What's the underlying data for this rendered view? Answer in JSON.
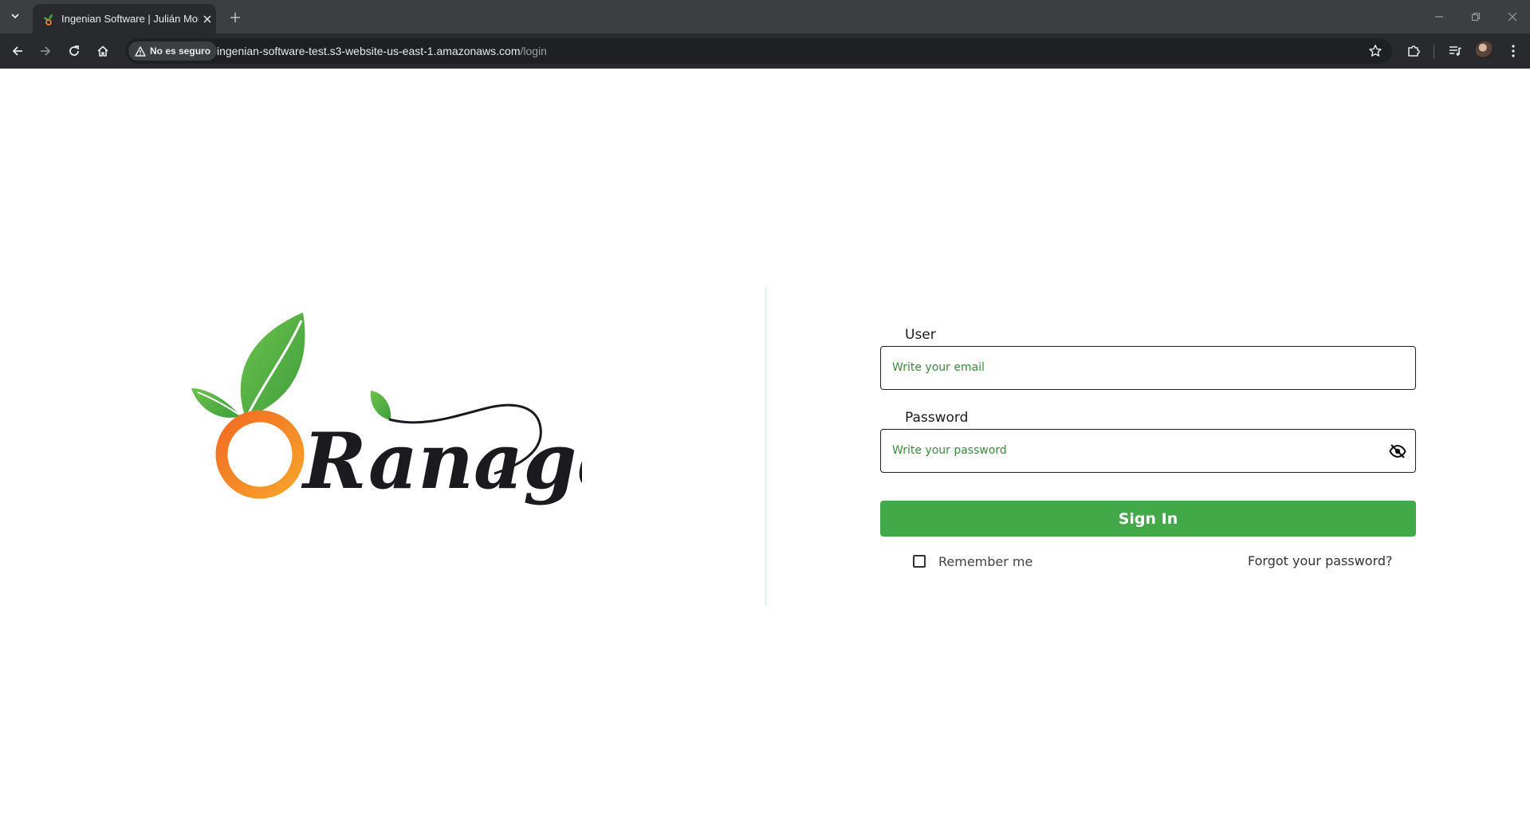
{
  "browser": {
    "tab": {
      "title": "Ingenian Software | Julián Mora"
    },
    "omnibox": {
      "security_label": "No es seguro",
      "url_host": "ingenian-software-test.s3-website-us-east-1.amazonaws.com",
      "url_path": "/login"
    },
    "icons": {
      "tab_search": "chevron-down-icon",
      "tab_favicon": "plant-favicon-icon",
      "tab_close": "close-icon",
      "new_tab": "plus-icon",
      "minimize": "minimize-icon",
      "restore": "restore-icon",
      "close_window": "close-icon",
      "back": "arrow-left-icon",
      "forward": "arrow-right-icon",
      "reload": "reload-icon",
      "home": "home-icon",
      "warning": "warning-triangle-icon",
      "bookmark": "star-icon",
      "extensions": "puzzle-icon",
      "media": "media-queue-icon",
      "profile": "avatar-icon",
      "menu": "kebab-menu-icon"
    }
  },
  "logo": {
    "text": "Ranage",
    "colors": {
      "leaf": "#4cae4c",
      "orange_start": "#f26b22",
      "orange_end": "#f7a42b",
      "script": "#1b1a1f"
    }
  },
  "login": {
    "user_label": "User",
    "user_placeholder": "Write your email",
    "password_label": "Password",
    "password_placeholder": "Write your password",
    "eye_icon": "eye-off-icon",
    "signin_label": "Sign In",
    "remember_label": "Remember me",
    "forgot_label": "Forgot your password?"
  },
  "colors": {
    "primary": "#41a948",
    "placeholder": "#3a8a3a",
    "divider": "#cfe7cf",
    "chrome_bg": "#3c3f42",
    "toolbar_bg": "#282a2d"
  }
}
